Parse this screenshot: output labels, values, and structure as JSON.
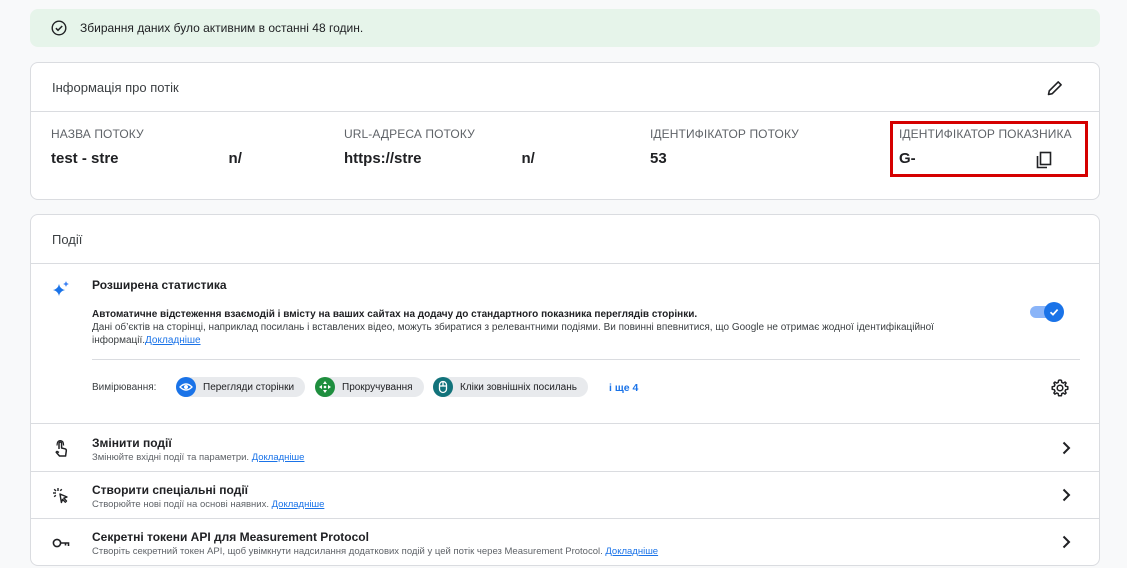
{
  "banner": {
    "text": "Збирання даних було активним в останні 48 годин.",
    "icon": "check-circle-icon",
    "color": "#e6f4ea"
  },
  "stream_details": {
    "title": "Інформація про потік",
    "fields": [
      {
        "label": "НАЗВА ПОТОКУ",
        "value_start": "test - stre",
        "value_end": "n/"
      },
      {
        "label": "URL-АДРЕСА ПОТОКУ",
        "value_start": "https://stre",
        "value_end": "n/"
      },
      {
        "label": "ІДЕНТИФІКАТОР ПОТОКУ",
        "value_start": "53",
        "value_end": ""
      },
      {
        "label": "ІДЕНТИФІКАТОР ПОКАЗНИКА",
        "value_start": "G-",
        "value_end": ""
      }
    ],
    "highlight_color": "#d50000"
  },
  "events": {
    "title": "Події",
    "enhanced": {
      "title": "Розширена статистика",
      "desc_line1": "Автоматичне відстеження взаємодій і вмісту на ваших сайтах на додачу до стандартного показника переглядів сторінки.",
      "desc_line2": "Дані об’єктів на сторінці, наприклад посилань і вставлених відео, можуть збиратися з релевантними подіями. Ви повинні впевнитися, що Google не отримає жодної ідентифікаційної інформації.",
      "learn_more": "Докладніше",
      "toggle_on": true
    },
    "measurement": {
      "label": "Вимірювання:",
      "chips": [
        {
          "label": "Перегляди сторінки",
          "icon": "eye-icon",
          "color": "#1a73e8"
        },
        {
          "label": "Прокручування",
          "icon": "scroll-arrows-icon",
          "color": "#1e8e3e"
        },
        {
          "label": "Кліки зовнішніх посилань",
          "icon": "mouse-icon",
          "color": "#12737b"
        }
      ],
      "more": "і ще 4"
    },
    "rows": [
      {
        "title": "Змінити події",
        "sub": "Змінюйте вхідні події та параметри.",
        "link": "Докладніше",
        "icon": "touch-icon"
      },
      {
        "title": "Створити спеціальні події",
        "sub": "Створюйте нові події на основі наявних.",
        "link": "Докладніше",
        "icon": "sparkle-click-icon"
      },
      {
        "title": "Секретні токени API для Measurement Protocol",
        "sub": "Створіть секретний токен API, щоб увімкнути надсилання додаткових подій у цей потік через Measurement Protocol.",
        "link": "Докладніше",
        "icon": "key-icon"
      }
    ]
  }
}
